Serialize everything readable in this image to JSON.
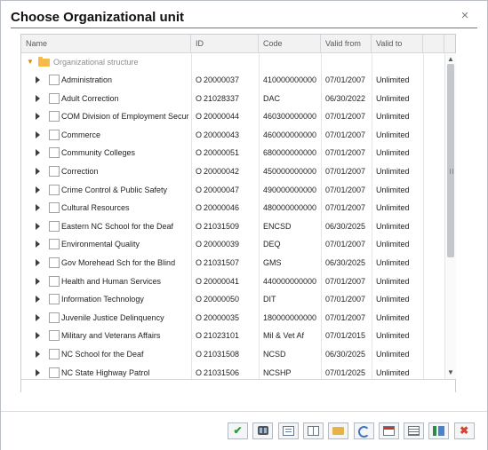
{
  "dialog": {
    "title": "Choose Organizational unit",
    "close_icon": "close-icon",
    "close_glyph": "×"
  },
  "table": {
    "headers": [
      "Name",
      "ID",
      "Code",
      "Valid from",
      "Valid to"
    ],
    "root": {
      "label": "Organizational structure",
      "chevron_glyph": "▼"
    },
    "rows": [
      {
        "name": "Administration",
        "id": "20000037",
        "code": "410000000000",
        "valid_from": "07/01/2007",
        "valid_to": "Unlimited"
      },
      {
        "name": "Adult Correction",
        "id": "21028337",
        "code": "DAC",
        "valid_from": "06/30/2022",
        "valid_to": "Unlimited"
      },
      {
        "name": "COM Division of Employment Secur",
        "id": "20000044",
        "code": "460300000000",
        "valid_from": "07/01/2007",
        "valid_to": "Unlimited"
      },
      {
        "name": "Commerce",
        "id": "20000043",
        "code": "460000000000",
        "valid_from": "07/01/2007",
        "valid_to": "Unlimited"
      },
      {
        "name": "Community Colleges",
        "id": "20000051",
        "code": "680000000000",
        "valid_from": "07/01/2007",
        "valid_to": "Unlimited"
      },
      {
        "name": "Correction",
        "id": "20000042",
        "code": "450000000000",
        "valid_from": "07/01/2007",
        "valid_to": "Unlimited"
      },
      {
        "name": "Crime Control & Public Safety",
        "id": "20000047",
        "code": "490000000000",
        "valid_from": "07/01/2007",
        "valid_to": "Unlimited"
      },
      {
        "name": "Cultural Resources",
        "id": "20000046",
        "code": "480000000000",
        "valid_from": "07/01/2007",
        "valid_to": "Unlimited"
      },
      {
        "name": "Eastern NC School for the Deaf",
        "id": "21031509",
        "code": "ENCSD",
        "valid_from": "06/30/2025",
        "valid_to": "Unlimited"
      },
      {
        "name": "Environmental Quality",
        "id": "20000039",
        "code": "DEQ",
        "valid_from": "07/01/2007",
        "valid_to": "Unlimited"
      },
      {
        "name": "Gov Morehead Sch for the Blind",
        "id": "21031507",
        "code": "GMS",
        "valid_from": "06/30/2025",
        "valid_to": "Unlimited"
      },
      {
        "name": "Health and Human Services",
        "id": "20000041",
        "code": "440000000000",
        "valid_from": "07/01/2007",
        "valid_to": "Unlimited"
      },
      {
        "name": "Information Technology",
        "id": "20000050",
        "code": "DIT",
        "valid_from": "07/01/2007",
        "valid_to": "Unlimited"
      },
      {
        "name": "Juvenile Justice Delinquency",
        "id": "20000035",
        "code": "180000000000",
        "valid_from": "07/01/2007",
        "valid_to": "Unlimited"
      },
      {
        "name": "Military and Veterans Affairs",
        "id": "21023101",
        "code": "Mil & Vet Af",
        "valid_from": "07/01/2015",
        "valid_to": "Unlimited"
      },
      {
        "name": "NC School for the Deaf",
        "id": "21031508",
        "code": "NCSD",
        "valid_from": "06/30/2025",
        "valid_to": "Unlimited"
      },
      {
        "name": "NC State Highway Patrol",
        "id": "21031506",
        "code": "NCSHP",
        "valid_from": "07/01/2025",
        "valid_to": "Unlimited"
      }
    ],
    "id_prefix": "O",
    "scroll_up_glyph": "▲",
    "scroll_down_glyph": "▼"
  },
  "toolbar": {
    "buttons": [
      {
        "name": "confirm-button",
        "icon": "checkmark-icon",
        "glyph": "✔",
        "color": "#2e9b3a"
      },
      {
        "name": "find-button",
        "icon": "binoculars-icon",
        "glyph": "",
        "color": "#4e5660"
      },
      {
        "name": "details-button",
        "icon": "document-icon",
        "glyph": "",
        "color": "#4b82c5"
      },
      {
        "name": "select-block-button",
        "icon": "grid-icon",
        "glyph": "",
        "color": "#6d747c"
      },
      {
        "name": "open-folder-button",
        "icon": "folder-icon",
        "glyph": "",
        "color": "#e4b34a"
      },
      {
        "name": "refresh-button",
        "icon": "refresh-icon",
        "glyph": "",
        "color": "#3f78be"
      },
      {
        "name": "calendar-button",
        "icon": "calendar-icon",
        "glyph": "",
        "color": "#c23b32"
      },
      {
        "name": "list-view-button",
        "icon": "list-icon",
        "glyph": "",
        "color": "#6d747c"
      },
      {
        "name": "tree-view-button",
        "icon": "tree-icon",
        "glyph": "",
        "color": "#2f8a45"
      },
      {
        "name": "cancel-button",
        "icon": "cancel-icon",
        "glyph": "✖",
        "color": "#d4432f"
      }
    ]
  }
}
